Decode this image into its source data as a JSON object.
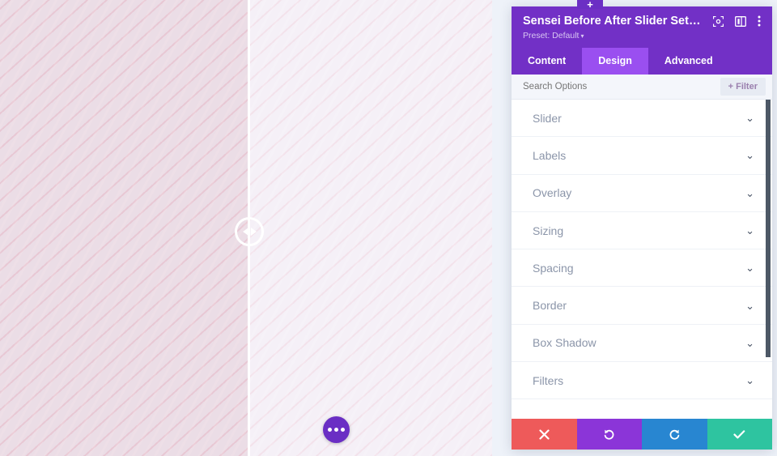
{
  "preview": {
    "label": "before-after-image-preview",
    "before_alt": "Pink cherry blossom flowers, original",
    "after_alt": "Pink cherry blossom flowers, edited",
    "handle_icon": "left-right-arrows-icon",
    "divider_position_percent": 50,
    "fab_icon": "ellipsis-icon"
  },
  "panel": {
    "add_tab_label": "+",
    "title": "Sensei Before After Slider Set…",
    "preset_label": "Preset: Default",
    "preset_caret": "▾",
    "header_icons": [
      {
        "name": "expand-icon",
        "glyph": "⦿"
      },
      {
        "name": "layout-columns-icon",
        "glyph": "▣"
      },
      {
        "name": "more-options-icon",
        "glyph": "⋮"
      }
    ],
    "tabs": [
      {
        "label": "Content",
        "active": false
      },
      {
        "label": "Design",
        "active": true
      },
      {
        "label": "Advanced",
        "active": false
      }
    ],
    "search": {
      "placeholder": "Search Options",
      "value": "",
      "filter_label": "+ Filter"
    },
    "sections": [
      {
        "label": "Slider",
        "chevron": "⌄"
      },
      {
        "label": "Labels",
        "chevron": "⌄"
      },
      {
        "label": "Overlay",
        "chevron": "⌄"
      },
      {
        "label": "Sizing",
        "chevron": "⌄"
      },
      {
        "label": "Spacing",
        "chevron": "⌄"
      },
      {
        "label": "Border",
        "chevron": "⌄"
      },
      {
        "label": "Box Shadow",
        "chevron": "⌄"
      },
      {
        "label": "Filters",
        "chevron": "⌄"
      }
    ],
    "actions": [
      {
        "name": "cancel-button",
        "glyph": "✖",
        "class": "cancel"
      },
      {
        "name": "undo-button",
        "glyph": "↺",
        "class": "undo"
      },
      {
        "name": "redo-button",
        "glyph": "↻",
        "class": "redo"
      },
      {
        "name": "save-button",
        "glyph": "✔",
        "class": "save"
      }
    ]
  },
  "colors": {
    "purple_header": "#7230c6",
    "purple_active_tab": "#9a4ff0",
    "cancel_red": "#ee5a5a",
    "undo_purple": "#8b35d8",
    "redo_blue": "#2886d1",
    "save_green": "#2ec4a0",
    "fab_purple": "#6a2ec4"
  }
}
